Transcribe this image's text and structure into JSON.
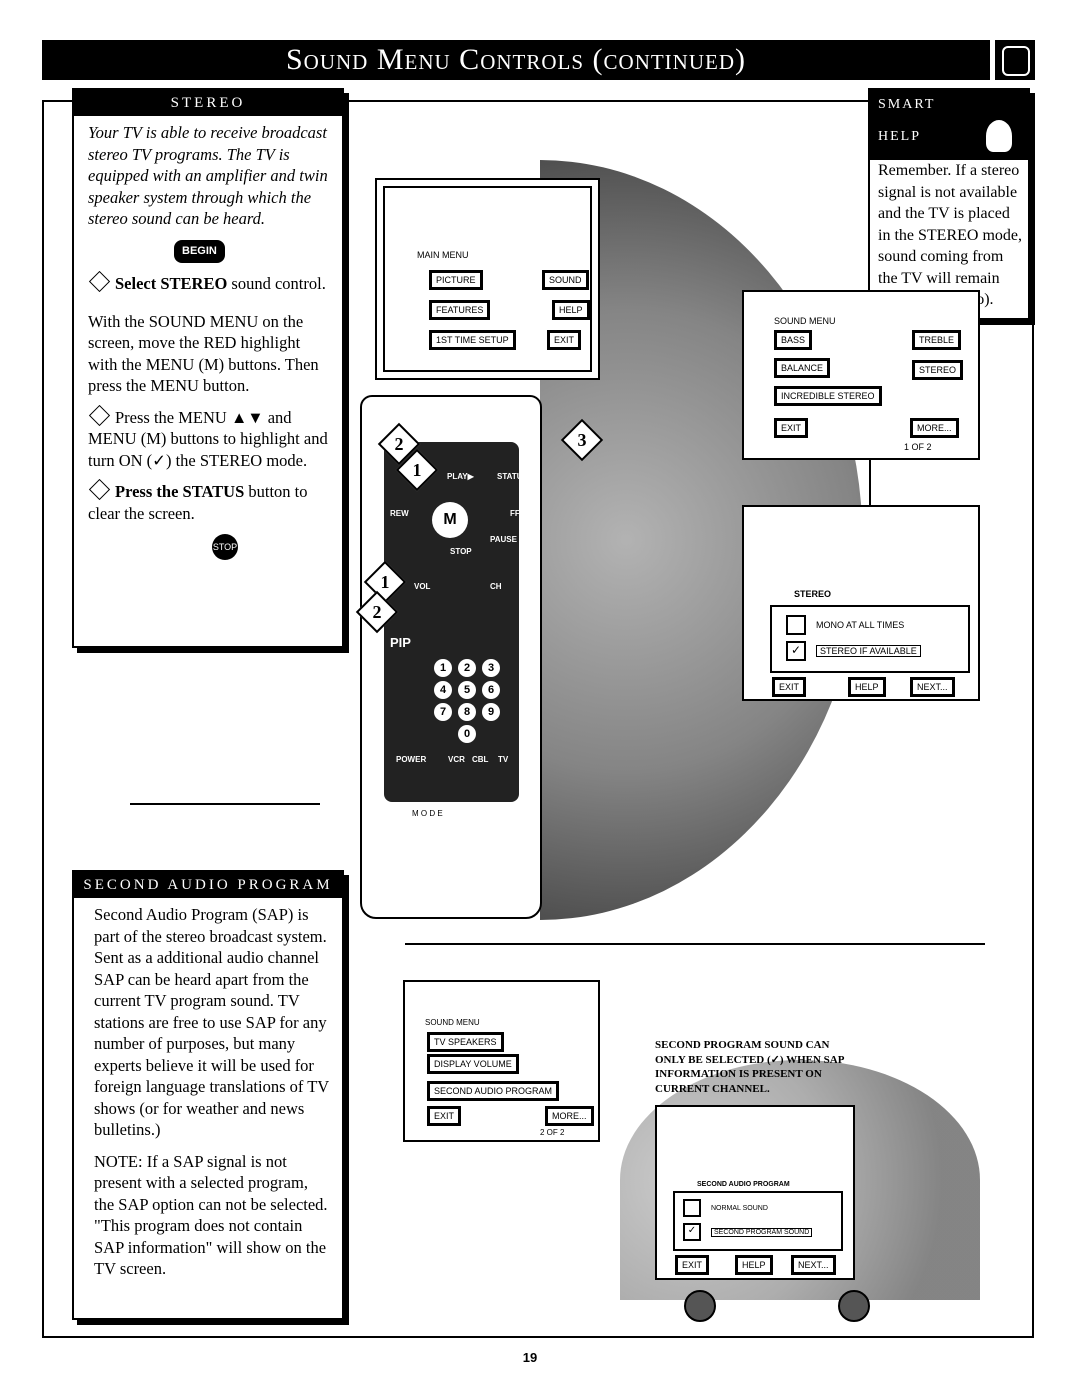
{
  "title": "Sound Menu Controls (continued)",
  "stereo": {
    "header": "STEREO",
    "intro": "Your TV is able to receive broadcast stereo TV programs. The TV is equipped with an amplifier and twin speaker system through which the stereo sound can be heard.",
    "begin": "BEGIN",
    "step1_bold": "Select STEREO",
    "step1_rest": " sound control.",
    "step1_detail": "With the SOUND MENU on the screen, move the RED highlight with the MENU (M) buttons. Then press the MENU button.",
    "step2": "Press the MENU ▲▼ and MENU (M) buttons to highlight and turn ON (✓) the STEREO mode.",
    "step3_bold": "Press the STATUS",
    "step3_rest": " button to clear the screen.",
    "stop": "STOP",
    "step_numbers": [
      "1",
      "2",
      "3"
    ]
  },
  "smart_help": {
    "header1": "SMART",
    "header2": "HELP",
    "text": "Remember. If a stereo signal is not available and the TV is placed in the STEREO mode, sound coming from the TV will remain monaural (mono)."
  },
  "main_menu": {
    "label": "MAIN MENU",
    "items": [
      "PICTURE",
      "SOUND",
      "FEATURES",
      "HELP",
      "1ST TIME SETUP",
      "EXIT"
    ]
  },
  "sound_menu_1": {
    "label": "SOUND MENU",
    "items": [
      "BASS",
      "TREBLE",
      "BALANCE",
      "STEREO",
      "INCREDIBLE STEREO",
      "EXIT",
      "MORE..."
    ],
    "page": "1 OF 2"
  },
  "stereo_screen": {
    "label": "STEREO",
    "options": [
      {
        "label": "MONO AT ALL TIMES",
        "checked": false
      },
      {
        "label": "STEREO IF AVAILABLE",
        "checked": true
      }
    ],
    "buttons": [
      "EXIT",
      "HELP",
      "NEXT..."
    ]
  },
  "remote": {
    "labels": [
      "PLAY▶",
      "STATUS",
      "REW",
      "FF",
      "STOP",
      "PAUSE",
      "VOL",
      "CH",
      "PIP",
      "POWER",
      "VCR",
      "CBL",
      "TV",
      "M O D E"
    ],
    "keys": [
      "1",
      "2",
      "3",
      "4",
      "5",
      "6",
      "7",
      "8",
      "9",
      "0"
    ],
    "callouts": [
      "2",
      "3",
      "1",
      "1",
      "2"
    ]
  },
  "sap": {
    "header": "SECOND AUDIO PROGRAM",
    "text": "Second Audio Program (SAP) is part of the stereo broadcast system. Sent as a additional audio channel SAP can be heard apart from the current TV program sound. TV stations are free to use SAP for any number of purposes, but many experts believe it will be used for foreign language translations of TV shows (or for weather and news bulletins.)",
    "note": "NOTE: If a SAP signal is not present with a selected program, the SAP option can not be selected. \"This program does not contain SAP information\" will show on the TV screen."
  },
  "sound_menu_2": {
    "label": "SOUND MENU",
    "items": [
      "TV SPEAKERS",
      "DISPLAY VOLUME",
      "SECOND AUDIO PROGRAM",
      "EXIT",
      "MORE..."
    ],
    "page": "2 OF 2"
  },
  "sap_caption": "SECOND PROGRAM SOUND CAN ONLY BE SELECTED (✓) WHEN SAP INFORMATION IS PRESENT ON CURRENT CHANNEL.",
  "sap_screen": {
    "label": "SECOND AUDIO PROGRAM",
    "options": [
      {
        "label": "NORMAL SOUND",
        "checked": false
      },
      {
        "label": "SECOND PROGRAM SOUND",
        "checked": true
      }
    ],
    "buttons": [
      "EXIT",
      "HELP",
      "NEXT..."
    ]
  },
  "page_number": "19"
}
